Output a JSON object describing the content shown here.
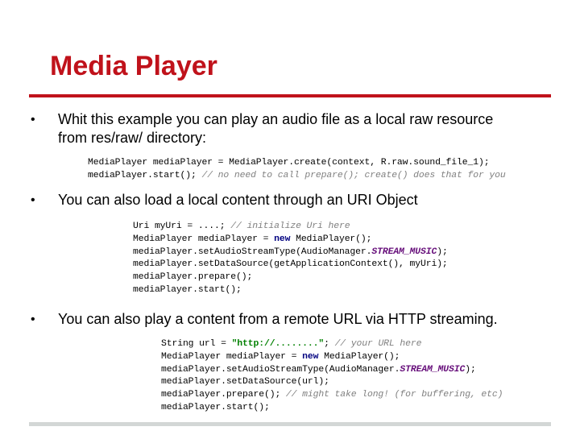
{
  "slide": {
    "title": "Media Player",
    "colors": {
      "title": "#c0121b",
      "rule": "#c0121b",
      "bottom_rule": "#d3d7d6",
      "comment": "#808080",
      "keyword": "#000080",
      "constant": "#660e7a",
      "string": "#008000"
    }
  },
  "bullets": [
    {
      "marker": "•",
      "lines": [
        "Whit this example you can play an audio file as a local raw resource",
        "from res/raw/ directory:"
      ],
      "code": [
        [
          {
            "t": "MediaPlayer mediaPlayer = MediaPlayer.create(context, R.raw.sound_file_1);",
            "k": "plain"
          }
        ],
        [
          {
            "t": "mediaPlayer.start(); ",
            "k": "plain"
          },
          {
            "t": "// no need to call prepare(); create() does that for you",
            "k": "comment"
          }
        ]
      ]
    },
    {
      "marker": "•",
      "lines": [
        "You can also load a local content through an URI Object"
      ],
      "code": [
        [
          {
            "t": "Uri myUri = ....; ",
            "k": "plain"
          },
          {
            "t": "// initialize Uri here",
            "k": "comment"
          }
        ],
        [
          {
            "t": "MediaPlayer mediaPlayer = ",
            "k": "plain"
          },
          {
            "t": "new",
            "k": "keyword"
          },
          {
            "t": " MediaPlayer();",
            "k": "plain"
          }
        ],
        [
          {
            "t": "mediaPlayer.setAudioStreamType(AudioManager.",
            "k": "plain"
          },
          {
            "t": "STREAM_MUSIC",
            "k": "constant"
          },
          {
            "t": ");",
            "k": "plain"
          }
        ],
        [
          {
            "t": "mediaPlayer.setDataSource(getApplicationContext(), myUri);",
            "k": "plain"
          }
        ],
        [
          {
            "t": "mediaPlayer.prepare();",
            "k": "plain"
          }
        ],
        [
          {
            "t": "mediaPlayer.start();",
            "k": "plain"
          }
        ]
      ]
    },
    {
      "marker": "•",
      "lines": [
        "You can also play a content from a remote URL via HTTP streaming."
      ],
      "code": [
        [
          {
            "t": "String url = ",
            "k": "plain"
          },
          {
            "t": "\"http://........\"",
            "k": "string"
          },
          {
            "t": "; ",
            "k": "plain"
          },
          {
            "t": "// your URL here",
            "k": "comment"
          }
        ],
        [
          {
            "t": "MediaPlayer mediaPlayer = ",
            "k": "plain"
          },
          {
            "t": "new",
            "k": "keyword"
          },
          {
            "t": " MediaPlayer();",
            "k": "plain"
          }
        ],
        [
          {
            "t": "mediaPlayer.setAudioStreamType(AudioManager.",
            "k": "plain"
          },
          {
            "t": "STREAM_MUSIC",
            "k": "constant"
          },
          {
            "t": ");",
            "k": "plain"
          }
        ],
        [
          {
            "t": "mediaPlayer.setDataSource(url);",
            "k": "plain"
          }
        ],
        [
          {
            "t": "mediaPlayer.prepare(); ",
            "k": "plain"
          },
          {
            "t": "// might take long! (for buffering, etc)",
            "k": "comment"
          }
        ],
        [
          {
            "t": "mediaPlayer.start();",
            "k": "plain"
          }
        ]
      ]
    }
  ]
}
